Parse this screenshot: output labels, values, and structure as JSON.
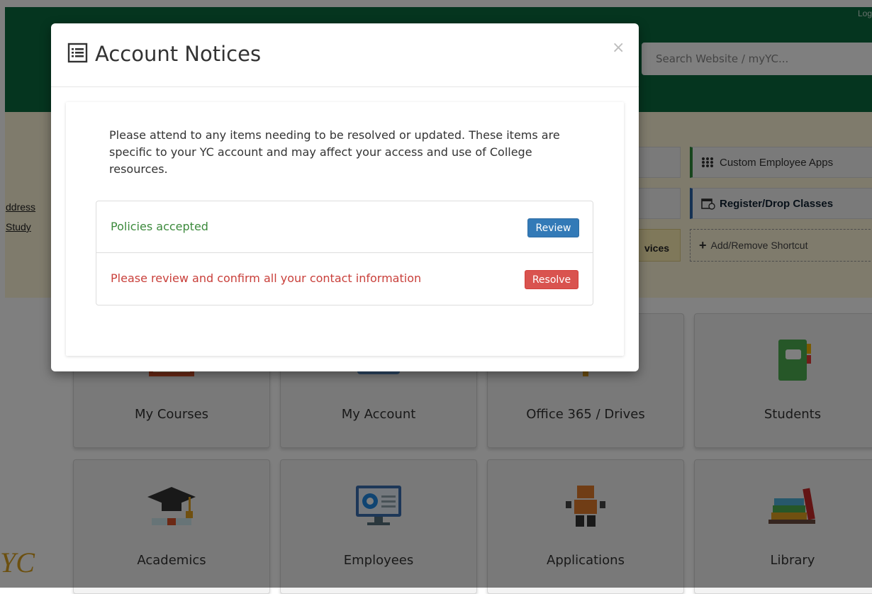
{
  "header": {
    "login_text": "Log",
    "search_placeholder": "Search Website / myYC..."
  },
  "left_links": [
    "ddress",
    "Study"
  ],
  "shortcuts": {
    "custom_apps": "Custom Employee Apps",
    "register": "Register/Drop Classes",
    "add_remove": "Add/Remove Shortcut",
    "services_partial": "vices"
  },
  "tiles": [
    {
      "label": "My Courses"
    },
    {
      "label": "My Account"
    },
    {
      "label": "Office 365 / Drives"
    },
    {
      "label": "Students"
    },
    {
      "label": "Academics"
    },
    {
      "label": "Employees"
    },
    {
      "label": "Applications"
    },
    {
      "label": "Library"
    }
  ],
  "logo_partial": "YC",
  "modal": {
    "title": "Account Notices",
    "close_glyph": "×",
    "intro": "Please attend to any items needing to be resolved or updated. These items are specific to your YC account and may affect your access and use of College resources.",
    "items": [
      {
        "text": "Policies accepted",
        "action": "Review",
        "status": "ok"
      },
      {
        "text": "Please review and confirm all your contact information",
        "action": "Resolve",
        "status": "needs-action"
      }
    ]
  },
  "colors": {
    "header_green": "#0b6b3f",
    "review_blue": "#337ab7",
    "resolve_red": "#d9534f",
    "ok_text": "#3c8a3c",
    "bad_text": "#c9403b"
  }
}
